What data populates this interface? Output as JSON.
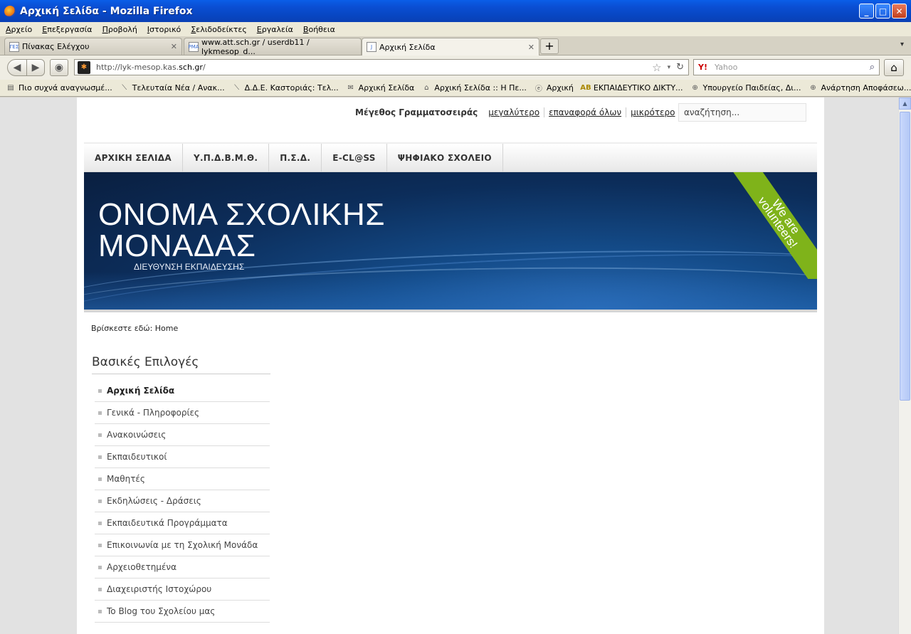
{
  "window": {
    "title": "Αρχική Σελίδα - Mozilla Firefox"
  },
  "menu": [
    "Αρχείο",
    "Επεξεργασία",
    "Προβολή",
    "Ιστορικό",
    "Σελιδοδείκτες",
    "Εργαλεία",
    "Βοήθεια"
  ],
  "tabs": [
    {
      "label": "Πίνακας Ελέγχου",
      "fav": "ΓΕΣ"
    },
    {
      "label": "www.att.sch.gr / userdb11 / lykmesop_d...",
      "fav": "PMA"
    },
    {
      "label": "Αρχική Σελίδα",
      "fav": "J"
    }
  ],
  "nav": {
    "url": "http://lyk-mesop.kas.sch.gr/",
    "url_prefix": "http://lyk-mesop.kas.",
    "url_domain": "sch.gr",
    "url_suffix": "/",
    "search_engine": "Y!",
    "search_placeholder": "Yahoo"
  },
  "bookmarks": [
    {
      "label": "Πιο συχνά αναγνωσμέ...",
      "icon": "bookmarks-folder-icon"
    },
    {
      "label": "Τελευταία Νέα / Ανακ...",
      "icon": "rss-icon"
    },
    {
      "label": "Δ.Δ.Ε. Καστοριάς: Τελ...",
      "icon": "rss-icon"
    },
    {
      "label": "Αρχική Σελίδα",
      "icon": "mail-icon"
    },
    {
      "label": "Αρχική Σελίδα :: Η Πε...",
      "icon": "home-icon"
    },
    {
      "label": "Αρχική",
      "icon": "circle-e-icon"
    },
    {
      "label": "ΕΚΠΑΙΔΕΥΤΙΚΟ ΔΙΚΤΥ...",
      "icon": "ab-icon"
    },
    {
      "label": "Υπουργείο Παιδείας, Δι...",
      "icon": "globe-icon"
    },
    {
      "label": "Ανάρτηση Αποφάσεω...",
      "icon": "globe-icon"
    }
  ],
  "page": {
    "font_size_label": "Μέγεθος Γραμματοσειράς",
    "font_links": [
      "μεγαλύτερο",
      "επαναφορά όλων",
      "μικρότερο"
    ],
    "search_value": "αναζήτηση...",
    "main_nav": [
      "ΑΡΧΙΚΗ ΣΕΛΙΔΑ",
      "Υ.Π.Δ.Β.Μ.Θ.",
      "Π.Σ.Δ.",
      "E-CL@SS",
      "ΨΗΦΙΑΚΟ ΣΧΟΛΕΙΟ"
    ],
    "banner": {
      "school_line1": "ΟΝΟΜΑ ΣΧΟΛΙΚΗΣ",
      "school_line2": "ΜΟΝΑΔΑΣ",
      "subtitle": "ΔΙΕΥΘΥΝΣΗ ΕΚΠΑΙΔΕΥΣΗΣ",
      "ribbon_line1": "We are",
      "ribbon_line2": "volunteers!"
    },
    "breadcrumb": "Βρίσκεστε εδώ: Home",
    "sidebar_title": "Βασικές Επιλογές",
    "sidebar_items": [
      "Αρχική Σελίδα",
      "Γενικά - Πληροφορίες",
      "Ανακοινώσεις",
      "Εκπαιδευτικοί",
      "Μαθητές",
      "Εκδηλώσεις - Δράσεις",
      "Εκπαιδευτικά Προγράμματα",
      "Επικοινωνία με τη Σχολική Μονάδα",
      "Αρχειοθετημένα",
      "Διαχειριστής Ιστοχώρου",
      "To Blog του Σχολείου μας"
    ]
  }
}
